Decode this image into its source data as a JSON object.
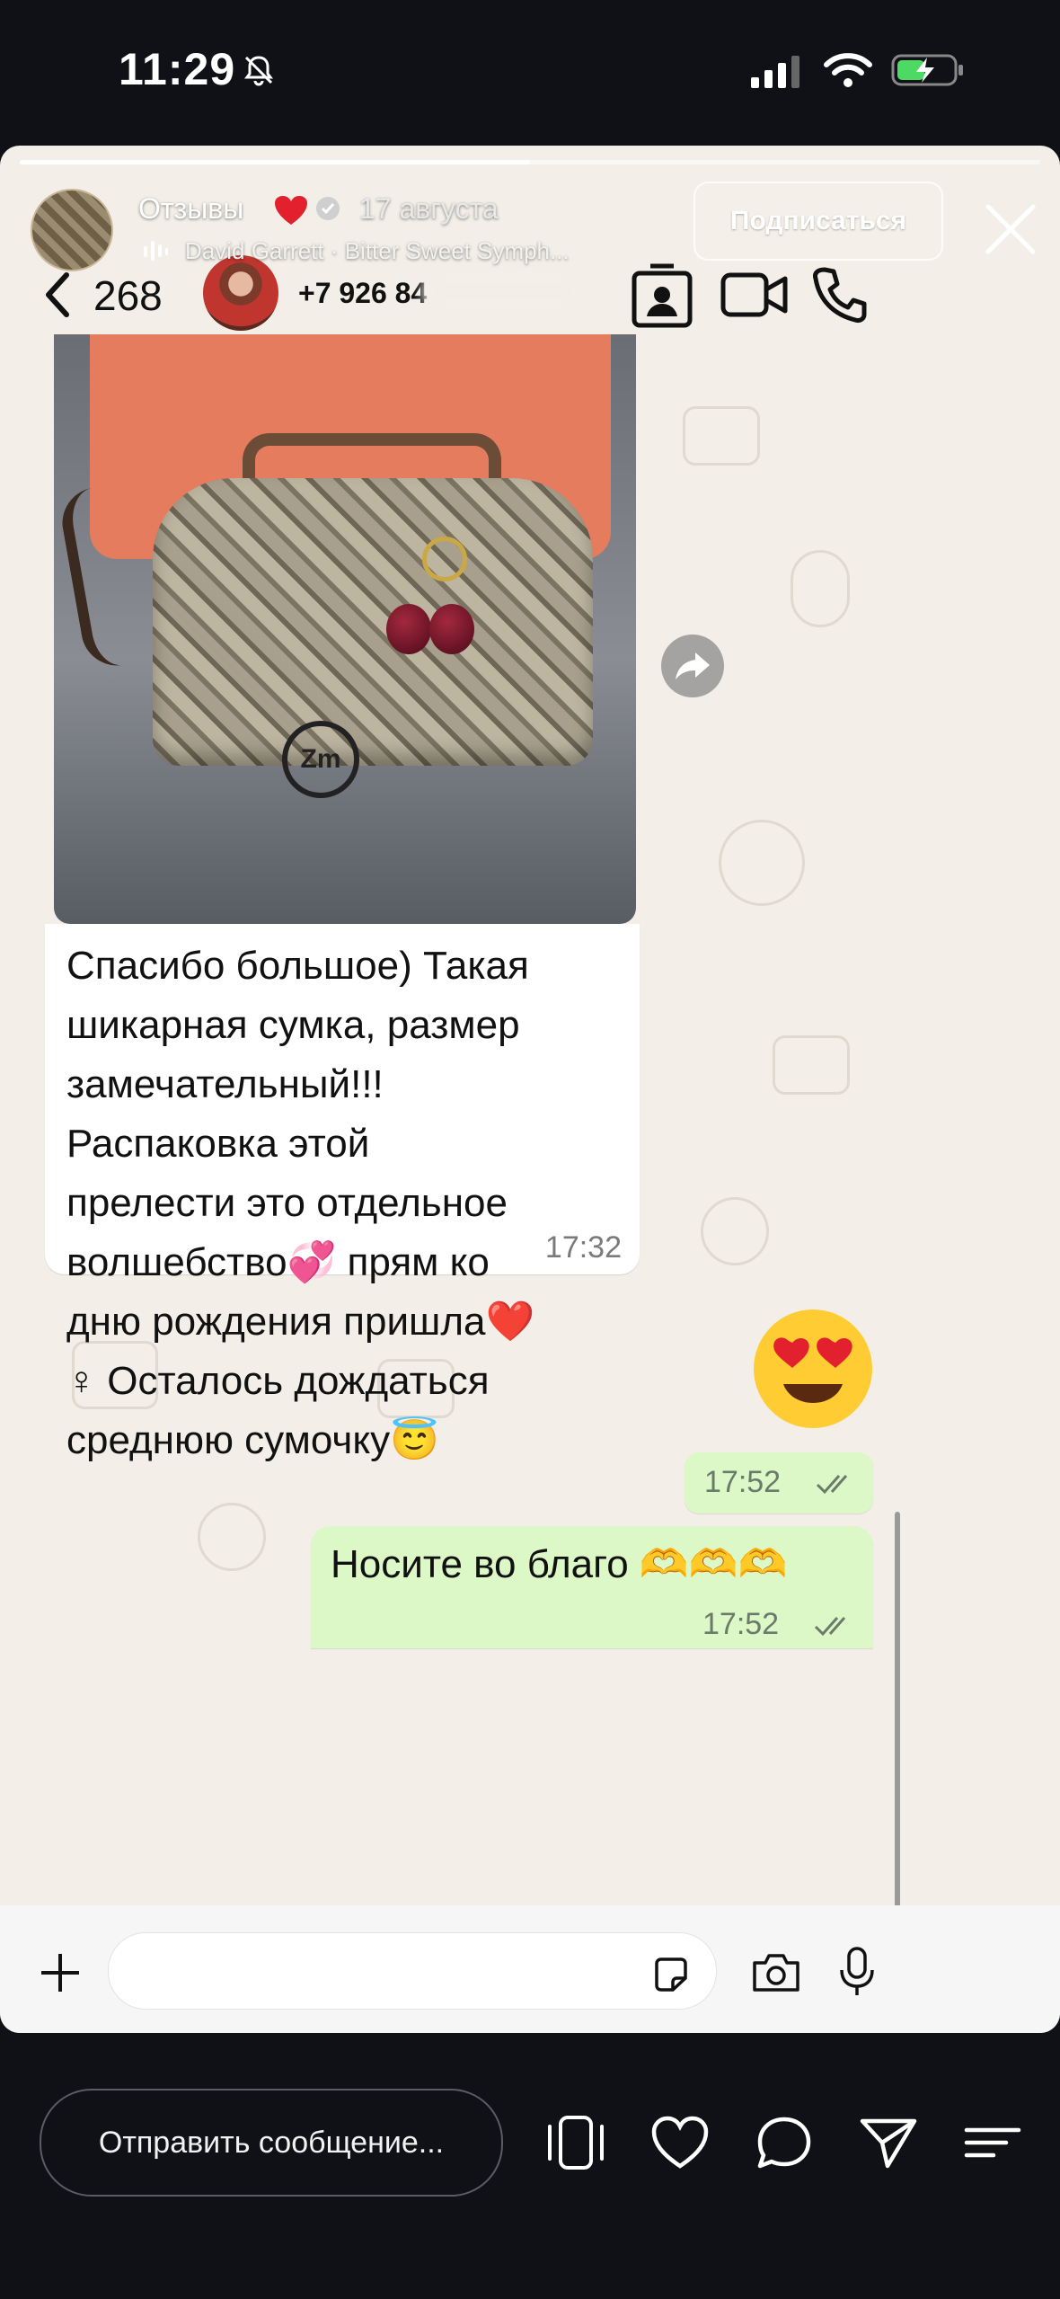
{
  "status_bar": {
    "time": "11:29"
  },
  "story": {
    "user_name": "Отзывы",
    "date": "17 августа",
    "music": "David Garrett · Bitter Sweet Symph...",
    "subscribe_label": "Подписаться",
    "progress": 0.5
  },
  "whatsapp": {
    "back_count": "268",
    "contact_phone": "+7 926 84",
    "incoming_message": {
      "text": "Спасибо большое) Такая\nшикарная сумка, размер\nзамечательный!!!\nРаспаковка этой\nпрелести это отдельное\nволшебство💞 прям ко\nдню рождения пришла❤️\n♀ Осталось дождаться\nсреднюю сумочку😇",
      "time": "17:32"
    },
    "outgoing": [
      {
        "emoji": "😍",
        "time": "17:52"
      },
      {
        "text": "Носите во благо 🫶🫶🫶",
        "time": "17:52"
      }
    ],
    "photo_logo": "Zm"
  },
  "bottom_bar": {
    "send_placeholder": "Отправить сообщение..."
  },
  "colors": {
    "outgoing_bubble": "#dbf8c6",
    "story_bg": "#f3efe8",
    "app_bg": "#0f1116"
  }
}
